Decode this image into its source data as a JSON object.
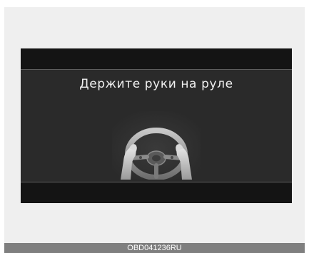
{
  "display": {
    "message": "Держите руки на руле",
    "illustration_icon": "hands-on-steering-wheel-icon"
  },
  "caption": {
    "code": "OBD041236RU"
  },
  "colors": {
    "display_background": "#1a1a1a",
    "display_panel": "#2a2a2a",
    "frame": "#efefef",
    "caption_bar": "#7f7f7f",
    "text": "#f0f0f0"
  }
}
